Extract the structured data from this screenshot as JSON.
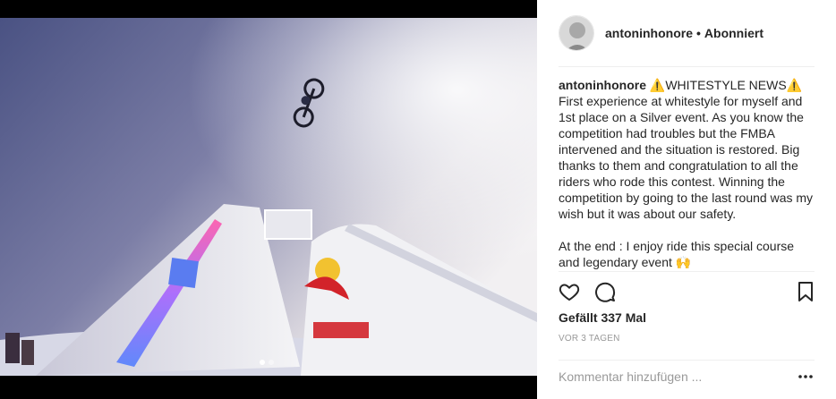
{
  "post": {
    "media": {
      "description_icon": "photo",
      "carousel_total": 2,
      "carousel_active": 1
    },
    "header": {
      "username": "antoninhonore",
      "separator": "•",
      "follow_status": "Abonniert"
    },
    "caption": {
      "username": "antoninhonore",
      "text": " ⚠️WHITESTYLE NEWS⚠️\nFirst experience at whitestyle for myself and 1st place on a Silver event. As you know the competition had troubles but the FMBA intervened and the situation is restored. Big thanks to them and congratulation to all the riders who rode this contest. Winning the competition by going to the last round was my wish but it was about our safety.\n\nAt the end : I enjoy ride this special course and legendary event 🙌"
    },
    "actions": {
      "like_icon": "heart-icon",
      "comment_icon": "comment-icon",
      "save_icon": "bookmark-icon"
    },
    "likes_text": "Gefällt 337 Mal",
    "timestamp": "VOR 3 TAGEN",
    "comment": {
      "placeholder": "Kommentar hinzufügen ...",
      "value": ""
    },
    "more_icon": "more-options-icon"
  }
}
